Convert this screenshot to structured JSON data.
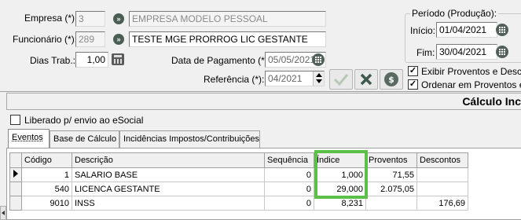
{
  "header": {
    "empresa_label": "Empresa (*):",
    "empresa_code": "3",
    "empresa_name": "EMPRESA MODELO PESSOAL",
    "funcionario_label": "Funcionário (*):",
    "funcionario_code": "289",
    "funcionario_name": "TESTE MGE PRORROG LIC GESTANTE",
    "dias_label": "Dias Trab.:",
    "dias_value": "1,00",
    "data_pagamento_label": "Data de Pagamento (*):",
    "data_pagamento_value": "05/05/2021",
    "referencia_label": "Referência (*):",
    "referencia_value": "04/2021"
  },
  "periodo": {
    "title": "Período (Produção):",
    "inicio_label": "Início:",
    "inicio_value": "01/04/2021",
    "fim_label": "Fim:",
    "fim_value": "30/04/2021"
  },
  "options": {
    "exibir_label": "Exibir Proventos e Descon",
    "ordenar_label": "Ordenar em Proventos e D",
    "exibir_checked": true,
    "ordenar_checked": true
  },
  "banner": {
    "title": "Cálculo Inc"
  },
  "esocial": {
    "label": "Liberado p/ envio ao eSocial",
    "checked": false
  },
  "tabs": [
    {
      "label": "Eventos",
      "active": true
    },
    {
      "label": "Base de Cálculo",
      "active": false
    },
    {
      "label": "Incidências Impostos/Contribuições",
      "active": false
    }
  ],
  "grid": {
    "columns": [
      "Código",
      "Descrição",
      "Sequência",
      "Índice",
      "Proventos",
      "Descontos"
    ],
    "rows": [
      {
        "codigo": "1",
        "descricao": "SALARIO BASE",
        "sequencia": "0",
        "indice": "1,000",
        "proventos": "71,55",
        "descontos": ""
      },
      {
        "codigo": "540",
        "descricao": "LICENCA GESTANTE",
        "sequencia": "0",
        "indice": "29,000",
        "proventos": "2.075,05",
        "descontos": ""
      },
      {
        "codigo": "9010",
        "descricao": "INSS",
        "sequencia": "0",
        "indice": "8,231",
        "proventos": "",
        "descontos": "176,69"
      }
    ]
  },
  "highlight_color": "#5cbf4a"
}
